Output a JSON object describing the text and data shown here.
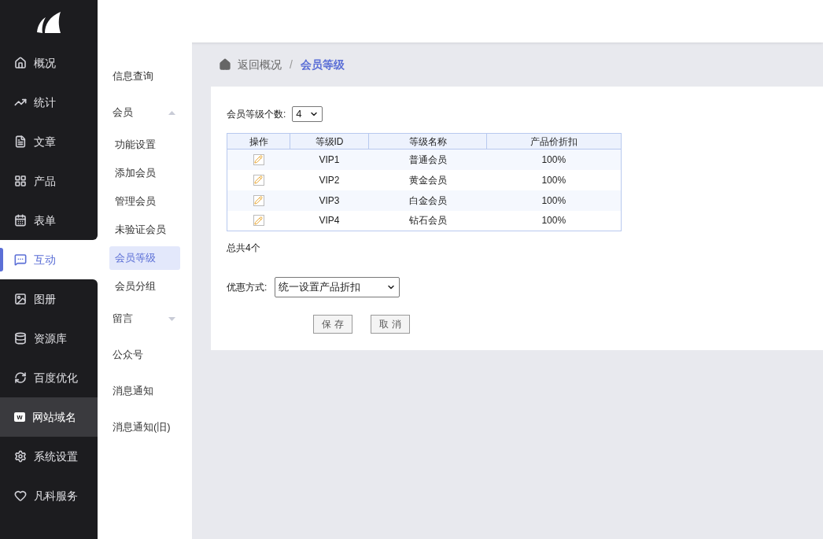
{
  "nav": [
    {
      "label": "概况",
      "selected": false,
      "highlighted": false
    },
    {
      "label": "统计",
      "selected": false,
      "highlighted": false
    },
    {
      "label": "文章",
      "selected": false,
      "highlighted": false
    },
    {
      "label": "产品",
      "selected": false,
      "highlighted": false
    },
    {
      "label": "表单",
      "selected": false,
      "highlighted": false
    },
    {
      "label": "互动",
      "selected": true,
      "highlighted": false
    },
    {
      "label": "图册",
      "selected": false,
      "highlighted": false
    },
    {
      "label": "资源库",
      "selected": false,
      "highlighted": false
    },
    {
      "label": "百度优化",
      "selected": false,
      "highlighted": false
    },
    {
      "label": "网站域名",
      "icon_letter": "w",
      "selected": false,
      "highlighted": true
    },
    {
      "label": "系统设置",
      "selected": false,
      "highlighted": false
    },
    {
      "label": "凡科服务",
      "selected": false,
      "highlighted": false
    }
  ],
  "submenu": [
    {
      "label": "信息查询",
      "selected": false
    },
    {
      "label": "会员",
      "expanded": true,
      "children": [
        {
          "label": "功能设置",
          "selected": false
        },
        {
          "label": "添加会员",
          "selected": false
        },
        {
          "label": "管理会员",
          "selected": false
        },
        {
          "label": "未验证会员",
          "selected": false
        },
        {
          "label": "会员等级",
          "selected": true
        },
        {
          "label": "会员分组",
          "selected": false
        }
      ]
    },
    {
      "label": "留言",
      "expanded": false
    },
    {
      "label": "公众号",
      "selected": false
    },
    {
      "label": "消息通知",
      "selected": false
    },
    {
      "label": "消息通知(旧)",
      "selected": false
    }
  ],
  "breadcrumb": {
    "back": "返回概况",
    "separator": "/",
    "current": "会员等级"
  },
  "level_count": {
    "label": "会员等级个数:",
    "value": "4"
  },
  "table": {
    "columns": [
      "操作",
      "等级ID",
      "等级名称",
      "产品价折扣"
    ],
    "rows": [
      {
        "id": "VIP1",
        "name": "普通会员",
        "discount": "100%"
      },
      {
        "id": "VIP2",
        "name": "黄金会员",
        "discount": "100%"
      },
      {
        "id": "VIP3",
        "name": "白金会员",
        "discount": "100%"
      },
      {
        "id": "VIP4",
        "name": "钻石会员",
        "discount": "100%"
      }
    ]
  },
  "total": "总共4个",
  "discount_mode": {
    "label": "优惠方式:",
    "value": "统一设置产品折扣"
  },
  "buttons": [
    "保 存",
    "取 消"
  ]
}
